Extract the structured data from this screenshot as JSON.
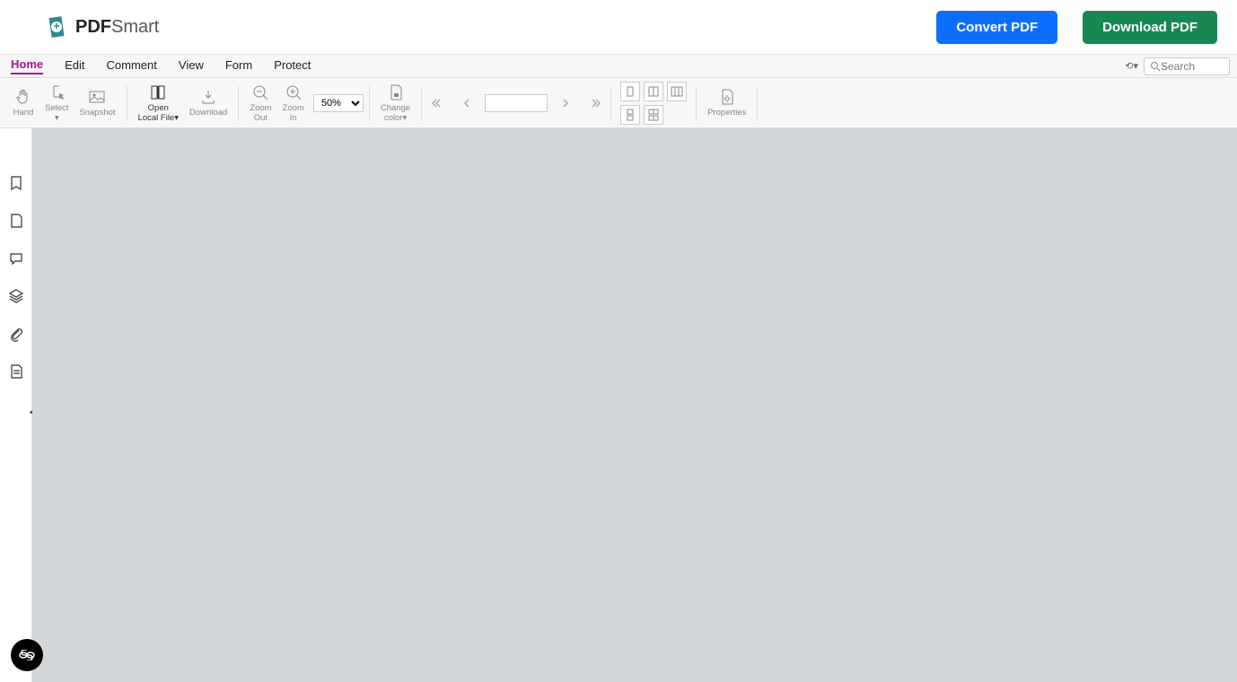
{
  "logo": {
    "brand": "PDF",
    "suffix": "Smart"
  },
  "header": {
    "convert": "Convert PDF",
    "download": "Download PDF"
  },
  "tabs": [
    "Home",
    "Edit",
    "Comment",
    "View",
    "Form",
    "Protect"
  ],
  "active_tab": 0,
  "search": {
    "placeholder": "Search"
  },
  "toolbar": {
    "hand": "Hand",
    "select": "Select",
    "snapshot": "Snapshot",
    "open": "Open",
    "open_sub": "Local File",
    "download": "Download",
    "zoom_out": "Zoom\nOut",
    "zoom_in": "Zoom\nIn",
    "zoom_value": "50%",
    "change_color": "Change\ncolor",
    "properties": "Properties"
  },
  "sidebar_items": [
    "bookmark",
    "page",
    "comment",
    "layers",
    "attachment",
    "form-field"
  ]
}
